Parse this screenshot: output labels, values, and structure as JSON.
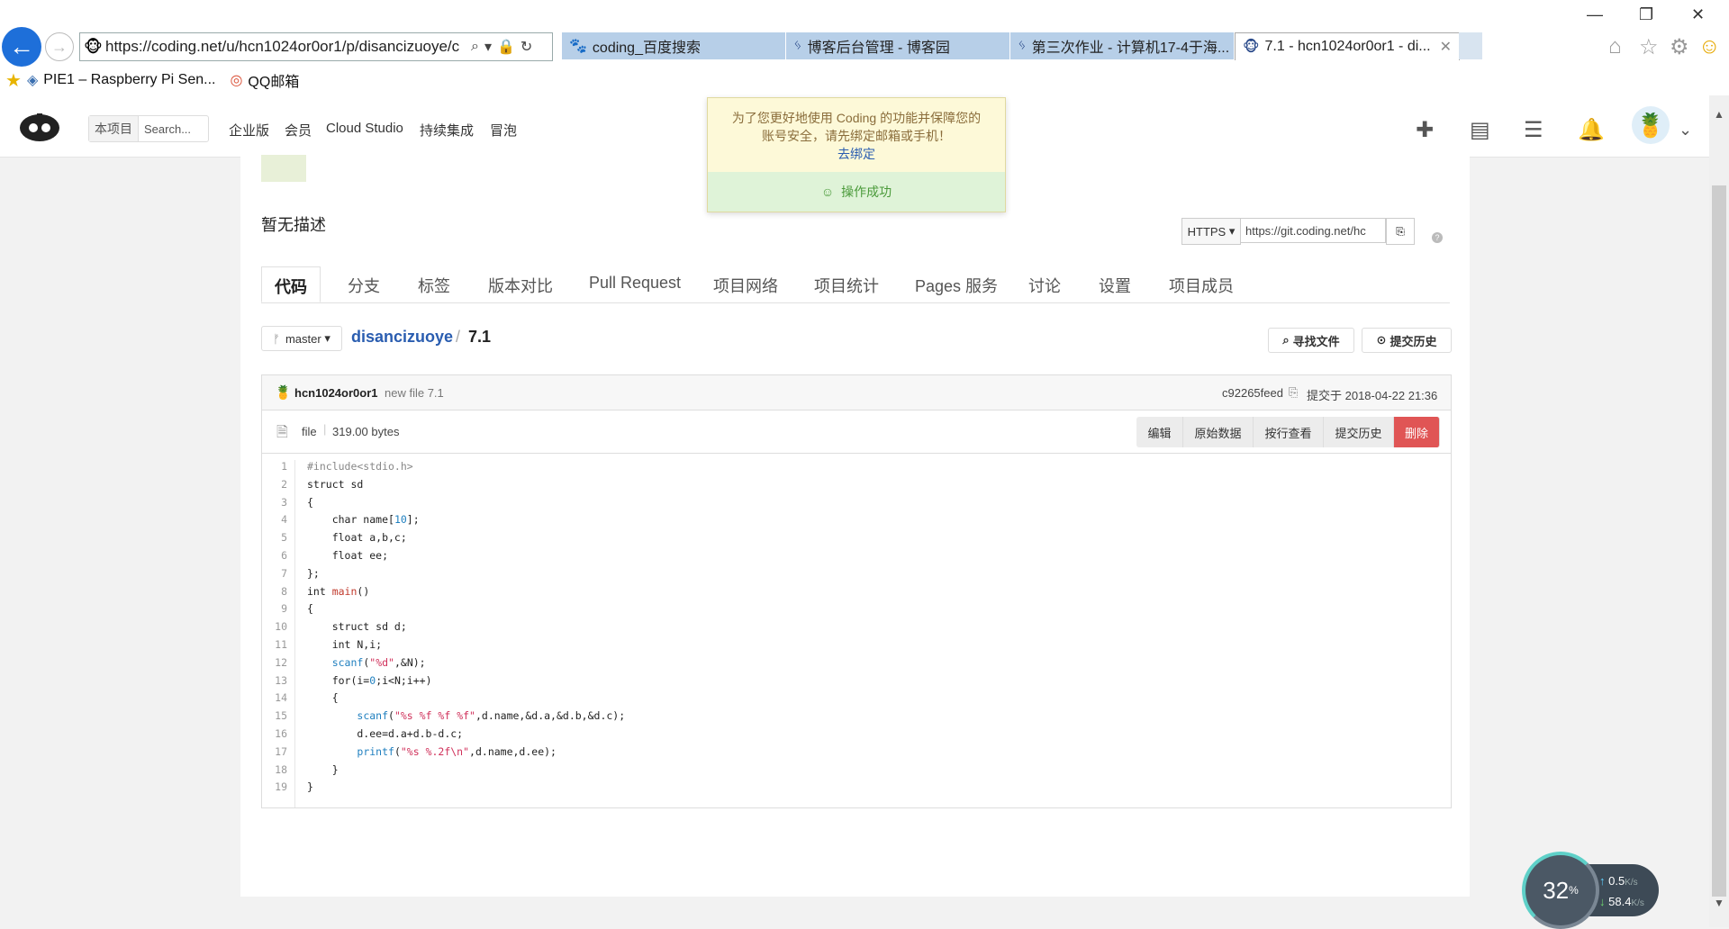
{
  "browser": {
    "url": "https://coding.net/u/hcn1024or0or1/p/disancizuoye/c",
    "tabs": [
      {
        "label": "coding_百度搜索"
      },
      {
        "label": "博客后台管理 - 博客园"
      },
      {
        "label": "第三次作业 - 计算机17-4于海..."
      },
      {
        "label": "7.1 - hcn1024or0or1 - di..."
      }
    ],
    "favorites": [
      {
        "label": "PIE1 – Raspberry Pi Sen..."
      },
      {
        "label": "QQ邮箱"
      }
    ]
  },
  "header": {
    "search_scope": "本项目",
    "search_placeholder": "Search...",
    "nav": [
      "企业版",
      "会员",
      "Cloud Studio",
      "持续集成",
      "冒泡"
    ]
  },
  "notification": {
    "warning_line1": "为了您更好地使用 Coding 的功能并保障您的",
    "warning_line2": "账号安全，请先绑定邮箱或手机！",
    "link": "去绑定",
    "success": "操作成功"
  },
  "project": {
    "description": "暂无描述",
    "clone_protocol": "HTTPS",
    "clone_url": "https://git.coding.net/hc",
    "tabs": [
      "代码",
      "分支",
      "标签",
      "版本对比",
      "Pull Request",
      "项目网络",
      "项目统计",
      "Pages 服务",
      "讨论",
      "设置",
      "项目成员"
    ],
    "branch": "master",
    "repo": "disancizuoye",
    "filename": "7.1",
    "find_file": "寻找文件",
    "history": "提交历史"
  },
  "commit": {
    "author": "hcn1024or0or1",
    "message": "new file 7.1",
    "hash": "c92265feed",
    "time": "提交于 2018-04-22 21:36"
  },
  "file": {
    "type": "file",
    "size": "319.00 bytes",
    "actions": [
      "编辑",
      "原始数据",
      "按行查看",
      "提交历史",
      "删除"
    ]
  },
  "code": [
    "#include<stdio.h>",
    "struct sd",
    "{",
    "    char name[10];",
    "    float a,b,c;",
    "    float ee;",
    "};",
    "int main()",
    "{",
    "    struct sd d;",
    "    int N,i;",
    "    scanf(\"%d\",&N);",
    "    for(i=0;i<N;i++)",
    "    {",
    "        scanf(\"%s %f %f %f\",d.name,&d.a,&d.b,&d.c);",
    "        d.ee=d.a+d.b-d.c;",
    "        printf(\"%s %.2f\\n\",d.name,d.ee);",
    "    }",
    "}"
  ],
  "speed": {
    "percent": "32",
    "percent_unit": "%",
    "up": "0.5",
    "down": "58.4",
    "unit": "K/s"
  }
}
